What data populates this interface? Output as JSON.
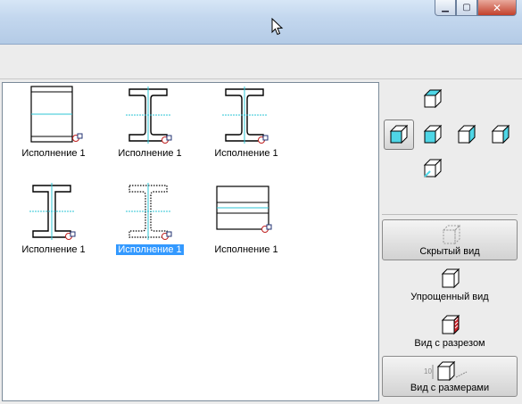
{
  "window": {
    "minimize_glyph": "▁",
    "maximize_glyph": "▢",
    "close_glyph": "✕"
  },
  "items": [
    {
      "label": "Исполнение 1",
      "icon": "beam-side-flange-icon",
      "selected": false
    },
    {
      "label": "Исполнение 1",
      "icon": "i-beam-section-icon",
      "selected": false
    },
    {
      "label": "Исполнение 1",
      "icon": "i-beam-section-icon",
      "selected": false
    },
    {
      "label": "Исполнение 1",
      "icon": "i-beam-section-simplified-icon",
      "selected": false
    },
    {
      "label": "Исполнение 1",
      "icon": "i-beam-section-hidden-icon",
      "selected": true
    },
    {
      "label": "Исполнение 1",
      "icon": "beam-top-view-icon",
      "selected": false
    }
  ],
  "view_panel": {
    "hidden_view": "Скрытый вид",
    "simplified_view": "Упрощенный вид",
    "section_view": "Вид с разрезом",
    "dimension_view": "Вид с размерами",
    "dimension_value": "10"
  },
  "colors": {
    "accent": "#3399ff",
    "cyan_face": "#4fd6e6",
    "section_red": "#d0232a"
  }
}
